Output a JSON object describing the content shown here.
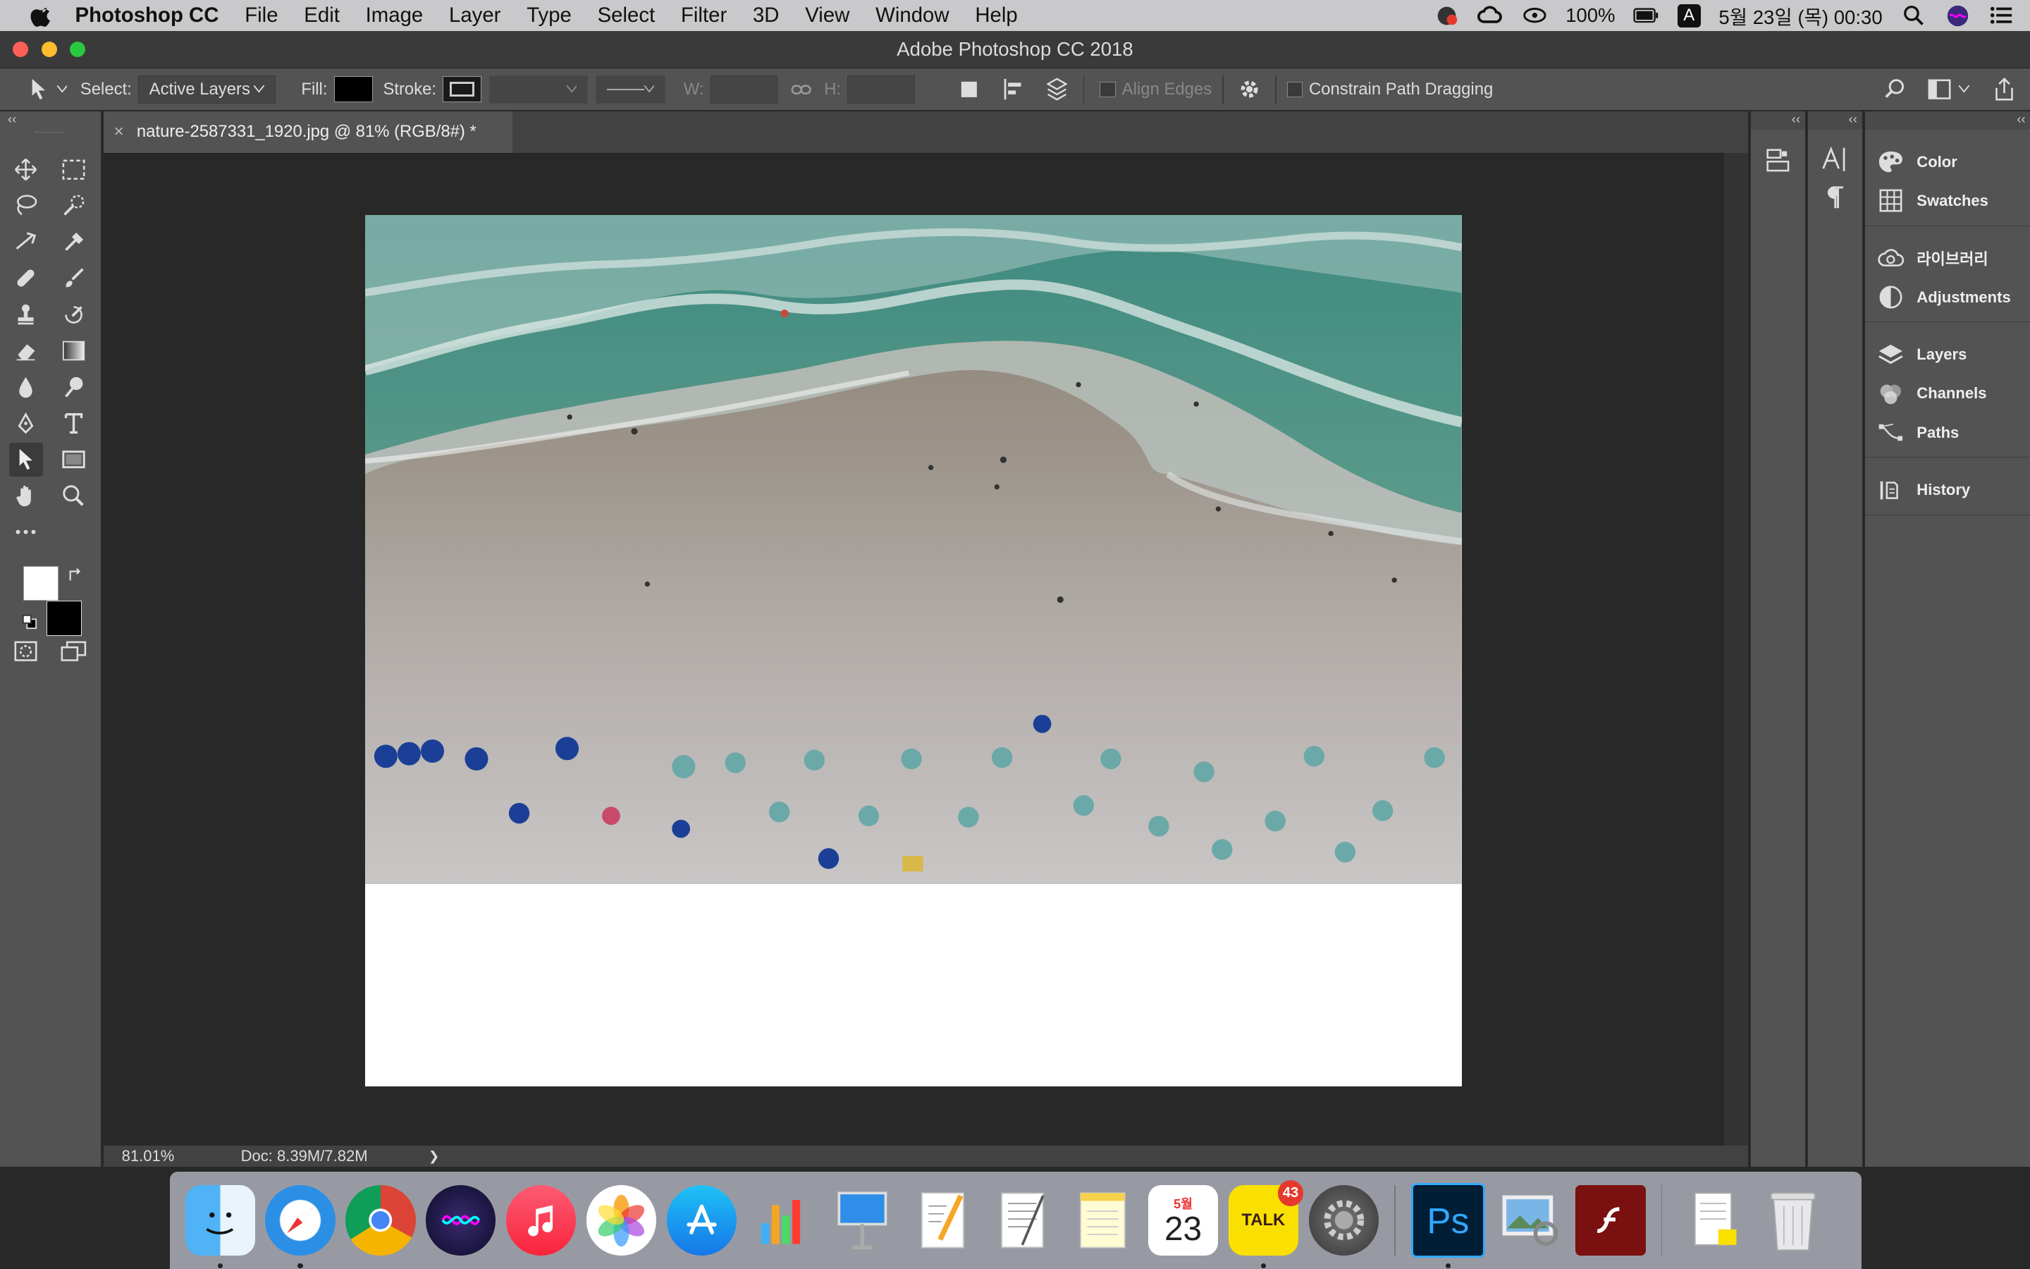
{
  "menubar": {
    "app_name": "Photoshop CC",
    "items": [
      "File",
      "Edit",
      "Image",
      "Layer",
      "Type",
      "Select",
      "Filter",
      "3D",
      "View",
      "Window",
      "Help"
    ],
    "battery": "100%",
    "input_indicator": "A",
    "datetime": "5월 23일 (목)  00:30"
  },
  "window": {
    "title": "Adobe Photoshop CC 2018"
  },
  "options": {
    "select_label": "Select:",
    "select_value": "Active Layers",
    "fill_label": "Fill:",
    "stroke_label": "Stroke:",
    "w_label": "W:",
    "h_label": "H:",
    "align_edges": "Align Edges",
    "constrain": "Constrain Path Dragging"
  },
  "document": {
    "tab_close": "×",
    "tab_title": "nature-2587331_1920.jpg @ 81% (RGB/8#) *",
    "zoom": "81.01%",
    "doc_info": "Doc: 8.39M/7.82M",
    "status_arrow": "❯"
  },
  "panels": {
    "groups": [
      [
        {
          "label": "Color",
          "icon": "color-icon"
        },
        {
          "label": "Swatches",
          "icon": "swatches-icon"
        }
      ],
      [
        {
          "label": "라이브러리",
          "icon": "libraries-icon"
        },
        {
          "label": "Adjustments",
          "icon": "adjustments-icon"
        }
      ],
      [
        {
          "label": "Layers",
          "icon": "layers-icon"
        },
        {
          "label": "Channels",
          "icon": "channels-icon"
        },
        {
          "label": "Paths",
          "icon": "paths-icon"
        }
      ],
      [
        {
          "label": "History",
          "icon": "history-icon"
        }
      ]
    ]
  },
  "dock": {
    "apps": [
      "Finder",
      "Safari",
      "Chrome",
      "Siri",
      "iTunes",
      "Photos",
      "App Store",
      "Numbers",
      "Keynote",
      "Pages",
      "TextEdit",
      "Notes",
      "Calendar",
      "KakaoTalk",
      "System Preferences",
      "Photoshop",
      "Preview",
      "Flash"
    ],
    "calendar_month": "5월",
    "calendar_day": "23",
    "kakao_label": "TALK",
    "kakao_badge": "43",
    "ps_label": "Ps"
  },
  "colors": {
    "ui_dark": "#282828",
    "panel": "#535353",
    "ps_blue": "#31a8ff"
  }
}
